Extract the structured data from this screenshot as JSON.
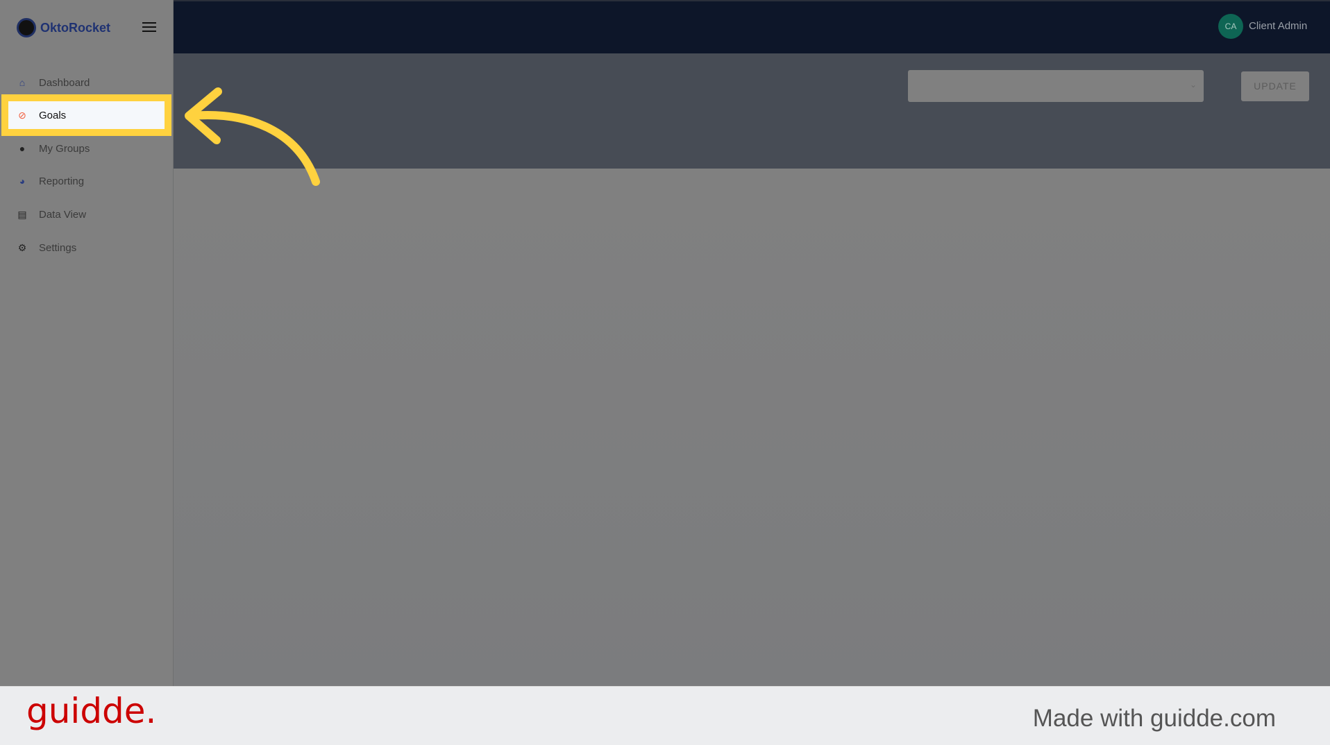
{
  "brand": {
    "name": "OktoRocket"
  },
  "sidebar": {
    "items": [
      {
        "label": "Dashboard",
        "icon": "store-icon"
      },
      {
        "label": "Goals",
        "icon": "compass-icon",
        "active": true
      },
      {
        "label": "My Groups",
        "icon": "user-icon"
      },
      {
        "label": "Reporting",
        "icon": "pie-chart-icon"
      },
      {
        "label": "Data View",
        "icon": "archive-icon"
      },
      {
        "label": "Settings",
        "icon": "gear-icon"
      }
    ]
  },
  "user": {
    "initials": "CA",
    "name": "Client Admin"
  },
  "toolbar": {
    "select_value": "",
    "update_label": "UPDATE"
  },
  "colors": {
    "highlight": "#ffd23f",
    "topbar": "#0d1629",
    "avatar": "#0e6554",
    "guidde": "#cc0000"
  },
  "footer": {
    "logo": "guidde.",
    "made_with": "Made with guidde.com"
  }
}
